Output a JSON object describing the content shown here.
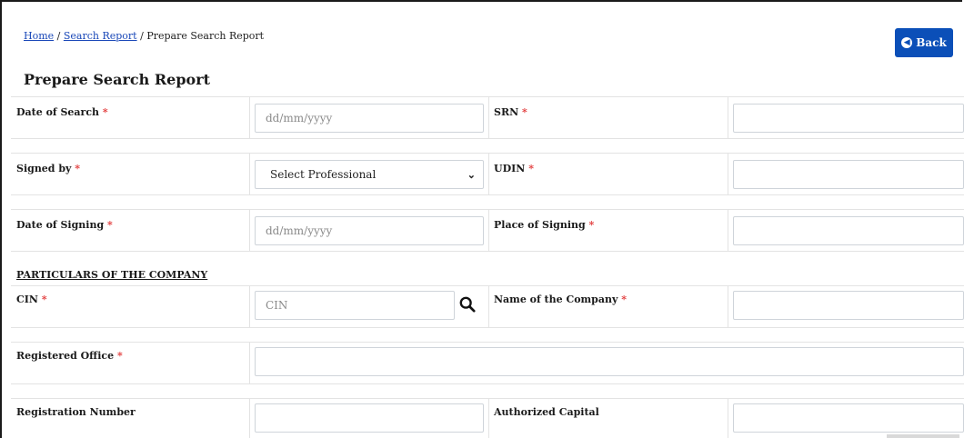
{
  "breadcrumb": {
    "home": "Home",
    "sep1": " / ",
    "search_report": "Search Report",
    "sep2": " / ",
    "current": "Prepare Search Report"
  },
  "header": {
    "back_label": "Back",
    "title": "Prepare Search Report"
  },
  "form": {
    "date_of_search": {
      "label": "Date of Search",
      "placeholder": "dd/mm/yyyy"
    },
    "srn": {
      "label": "SRN",
      "value": ""
    },
    "signed_by": {
      "label": "Signed by",
      "selected": "Select Professional"
    },
    "udin": {
      "label": "UDIN",
      "value": ""
    },
    "date_of_signing": {
      "label": "Date of Signing",
      "placeholder": "dd/mm/yyyy"
    },
    "place_of_signing": {
      "label": "Place of Signing",
      "value": ""
    },
    "section_company": "PARTICULARS OF THE COMPANY",
    "cin": {
      "label": "CIN",
      "placeholder": "CIN"
    },
    "company_name": {
      "label": "Name of the Company",
      "value": ""
    },
    "registered_office": {
      "label": "Registered Office",
      "value": ""
    },
    "registration_number": {
      "label": "Registration Number",
      "value": ""
    },
    "authorized_capital": {
      "label": "Authorized Capital",
      "value": ""
    },
    "required_mark": "*"
  },
  "colors": {
    "primary": "#0b4fb8",
    "required": "#e23b3b",
    "link": "#1a48b8"
  }
}
